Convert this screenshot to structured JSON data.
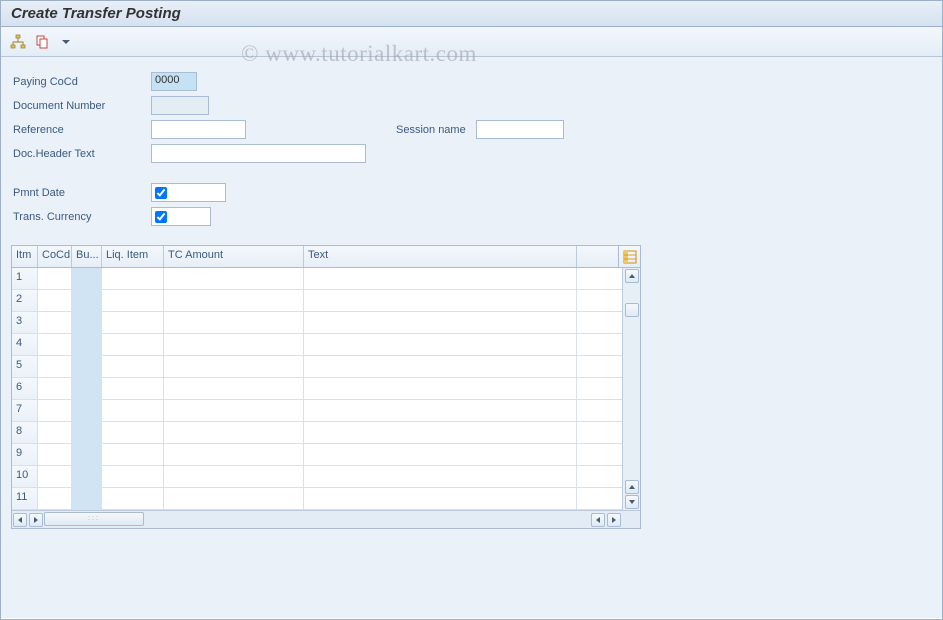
{
  "window": {
    "title": "Create Transfer Posting"
  },
  "watermark": "© www.tutorialkart.com",
  "toolbar": {
    "btn1_title": "Hierarchy",
    "btn2_title": "Copy",
    "dropdown_title": "More"
  },
  "form": {
    "paying_cocd_label": "Paying CoCd",
    "paying_cocd_value": "0000",
    "doc_number_label": "Document Number",
    "doc_number_value": "",
    "reference_label": "Reference",
    "reference_value": "",
    "session_name_label": "Session name",
    "session_name_value": "",
    "doc_header_text_label": "Doc.Header Text",
    "doc_header_text_value": "",
    "pmnt_date_label": "Pmnt Date",
    "pmnt_date_value": "",
    "trans_currency_label": "Trans. Currency",
    "trans_currency_value": ""
  },
  "grid": {
    "columns": {
      "itm": "Itm",
      "cocd": "CoCd",
      "bu": "Bu...",
      "liq": "Liq. Item",
      "tca": "TC Amount",
      "txt": "Text"
    },
    "config_title": "Configuration",
    "rows": [
      {
        "itm": "1",
        "cocd": "",
        "bu": "",
        "liq": "",
        "tca": "",
        "txt": ""
      },
      {
        "itm": "2",
        "cocd": "",
        "bu": "",
        "liq": "",
        "tca": "",
        "txt": ""
      },
      {
        "itm": "3",
        "cocd": "",
        "bu": "",
        "liq": "",
        "tca": "",
        "txt": ""
      },
      {
        "itm": "4",
        "cocd": "",
        "bu": "",
        "liq": "",
        "tca": "",
        "txt": ""
      },
      {
        "itm": "5",
        "cocd": "",
        "bu": "",
        "liq": "",
        "tca": "",
        "txt": ""
      },
      {
        "itm": "6",
        "cocd": "",
        "bu": "",
        "liq": "",
        "tca": "",
        "txt": ""
      },
      {
        "itm": "7",
        "cocd": "",
        "bu": "",
        "liq": "",
        "tca": "",
        "txt": ""
      },
      {
        "itm": "8",
        "cocd": "",
        "bu": "",
        "liq": "",
        "tca": "",
        "txt": ""
      },
      {
        "itm": "9",
        "cocd": "",
        "bu": "",
        "liq": "",
        "tca": "",
        "txt": ""
      },
      {
        "itm": "10",
        "cocd": "",
        "bu": "",
        "liq": "",
        "tca": "",
        "txt": ""
      },
      {
        "itm": "11",
        "cocd": "",
        "bu": "",
        "liq": "",
        "tca": "",
        "txt": ""
      }
    ]
  }
}
